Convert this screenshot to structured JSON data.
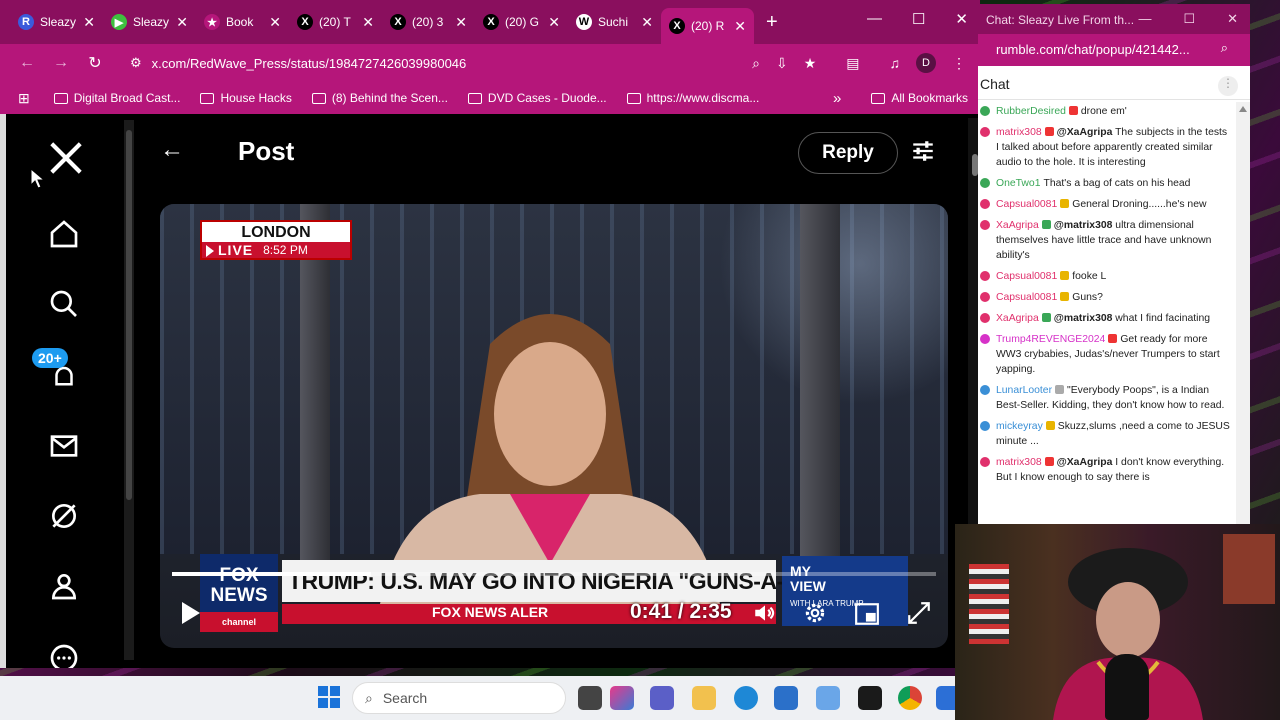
{
  "browser": {
    "tabs": [
      {
        "title": "Sleazy",
        "favicon": "R",
        "color": "#3b5bdb"
      },
      {
        "title": "Sleazy",
        "favicon": "▶",
        "color": "#3fbf3f"
      },
      {
        "title": "Book",
        "favicon": "★",
        "color": "#b5167a"
      },
      {
        "title": "(20) T",
        "favicon": "X",
        "color": "#000"
      },
      {
        "title": "(20) 3",
        "favicon": "X",
        "color": "#000"
      },
      {
        "title": "(20) G",
        "favicon": "X",
        "color": "#000"
      },
      {
        "title": "Suchi",
        "favicon": "W",
        "color": "#fff"
      },
      {
        "title": "(20) R",
        "favicon": "X",
        "color": "#000"
      }
    ],
    "address": "x.com/RedWave_Press/status/1984727426039980046",
    "bookmarks": [
      {
        "label": "Digital Broad Cast..."
      },
      {
        "label": "House Hacks"
      },
      {
        "label": "(8) Behind the Scen..."
      },
      {
        "label": "DVD Cases - Duode..."
      },
      {
        "label": "https://www.discma..."
      }
    ],
    "all_bookmarks": "All Bookmarks",
    "profile_letter": "D",
    "more_bookmarks": "»"
  },
  "x_app": {
    "page_title": "Post",
    "reply_label": "Reply",
    "notification_badge": "20+"
  },
  "video": {
    "location": "LONDON",
    "live_label": "LIVE",
    "live_time": "8:52 PM",
    "network_top": "FOX",
    "network_bottom": "NEWS",
    "network_sub": "channel",
    "headline": "TRUMP: U.S. MAY GO INTO NIGERIA \"GUNS-A-BLAZING\"",
    "alert": "FOX NEWS ALER",
    "show_top": "MY",
    "show_bottom": "VIEW",
    "show_host": "WITH LARA TRUMP",
    "time": "0:41 / 2:35",
    "progress": 0.26
  },
  "taskbar": {
    "search_placeholder": "Search"
  },
  "chat": {
    "window_title": "Chat: Sleazy Live From th...",
    "url": "rumble.com/chat/popup/421442...",
    "header": "Chat",
    "messages": [
      {
        "user": "RubberDesired",
        "color": "#3aa757",
        "text": "drone em'",
        "badge": "#e33"
      },
      {
        "user": "matrix308",
        "color": "#e0306c",
        "mention": "@XaAgripa",
        "text": "The subjects in the tests I talked about before apparently created similar audio to the hole. It is interesting",
        "badge": "#e33"
      },
      {
        "user": "OneTwo1",
        "color": "#3aa757",
        "text": "That's a bag of cats on his head",
        "badge": ""
      },
      {
        "user": "Capsual0081",
        "color": "#e0306c",
        "text": "General Droning......he's new",
        "badge": "#e8b400"
      },
      {
        "user": "XaAgripa",
        "color": "#e0306c",
        "mention": "@matrix308",
        "text": "ultra dimensional themselves have little trace and have unknown ability's",
        "badge": "#3aa757"
      },
      {
        "user": "Capsual0081",
        "color": "#e0306c",
        "text": "fooke L",
        "badge": "#e8b400"
      },
      {
        "user": "Capsual0081",
        "color": "#e0306c",
        "text": "Guns?",
        "badge": "#e8b400"
      },
      {
        "user": "XaAgripa",
        "color": "#e0306c",
        "mention": "@matrix308",
        "text": "what I find facinating",
        "badge": "#3aa757"
      },
      {
        "user": "Trump4REVENGE2024",
        "color": "#d632c8",
        "text": "Get ready for more WW3 crybabies, Judas's/never Trumpers to start yapping.",
        "badge": "#e33"
      },
      {
        "user": "LunarLooter",
        "color": "#3a8fd6",
        "text": "\"Everybody Poops\", is a Indian Best-Seller. Kidding, they don't know how to read.",
        "badge": "#aaa"
      },
      {
        "user": "mickeyray",
        "color": "#3a8fd6",
        "text": "Skuzz,slums ,need a come to JESUS minute ...",
        "badge": "#e8b400"
      },
      {
        "user": "matrix308",
        "color": "#e0306c",
        "mention": "@XaAgripa",
        "text": "I don't know everything. But I know enough to say there is",
        "badge": "#e33"
      }
    ]
  },
  "colors": {
    "chrome_dark": "#8a0f5e",
    "chrome": "#b5167a",
    "x_blue": "#1d9bf0",
    "fox_red": "#c8102e"
  }
}
